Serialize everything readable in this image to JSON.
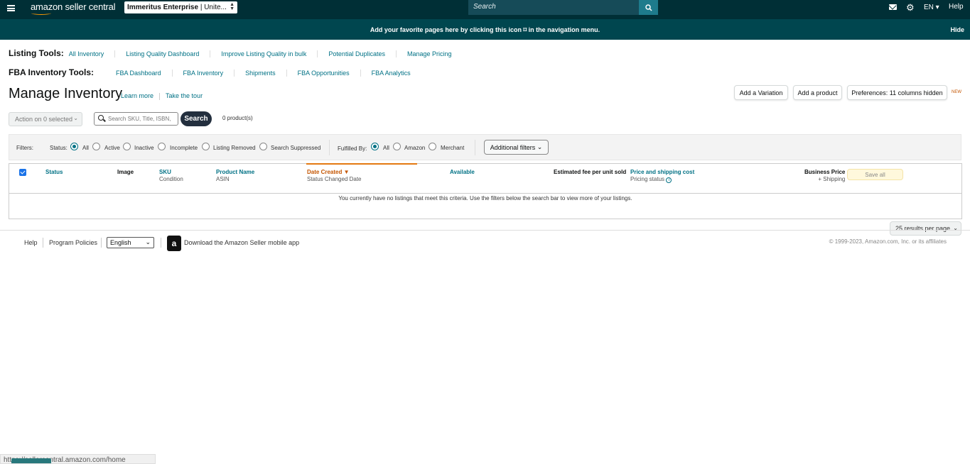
{
  "topnav": {
    "logo": "amazon seller central",
    "account": {
      "name": "Immeritus Enterprise",
      "region": " | Unite..."
    },
    "search_placeholder": "Search",
    "language": "EN ▾",
    "help": "Help"
  },
  "banner": {
    "message": "Add your favorite pages here by clicking this icon ⌑ in the navigation menu.",
    "hide": "Hide"
  },
  "listing_tools": {
    "title": "Listing Tools:",
    "links": [
      "All Inventory",
      "Listing Quality Dashboard",
      "Improve Listing Quality in bulk",
      "Potential Duplicates",
      "Manage Pricing"
    ]
  },
  "fba_tools": {
    "title": "FBA Inventory Tools:",
    "links": [
      "FBA Dashboard",
      "FBA Inventory",
      "Shipments",
      "FBA Opportunities",
      "FBA Analytics"
    ]
  },
  "page": {
    "title": "Manage Inventory",
    "learn_more": "Learn more",
    "tour": "Take the tour",
    "add_variation": "Add a Variation",
    "add_product": "Add a product",
    "preferences": "Preferences: 11 columns hidden",
    "new_tag": "NEW"
  },
  "toolbar": {
    "action": "Action on 0 selected",
    "search_placeholder": "Search SKU, Title, ISBN,",
    "search_btn": "Search",
    "count": "0 product(s)"
  },
  "filters": {
    "label": "Filters:",
    "status_label": "Status:",
    "status": [
      "All",
      "Active",
      "Inactive",
      "Incomplete",
      "Listing Removed",
      "Search Suppressed"
    ],
    "fulfilled_label": "Fulfilled By:",
    "fulfilled": [
      "All",
      "Amazon",
      "Merchant"
    ],
    "additional": "Additional filters"
  },
  "table": {
    "status": "Status",
    "image": "Image",
    "sku": "SKU",
    "condition": "Condition",
    "product_name": "Product Name",
    "asin": "ASIN",
    "date_created": "Date Created",
    "status_changed": "Status Changed Date",
    "available": "Available",
    "est_fee": "Estimated fee per unit sold",
    "price_shipping": "Price and shipping cost",
    "pricing_status": "Pricing status",
    "business_price": "Business Price",
    "plus_shipping": "+ Shipping",
    "save_all": "Save all",
    "empty_message": "You currently have no listings that meet this criteria. Use the filters below the search bar to view more of your listings."
  },
  "results_per_page": "25 results per page",
  "footer": {
    "help": "Help",
    "policies": "Program Policies",
    "language": "English",
    "app": "Download the Amazon Seller mobile app",
    "copyright": "© 1999-2023, Amazon.com, Inc. or its affiliates"
  },
  "status_url": "https://sellercentral.amazon.com/home"
}
